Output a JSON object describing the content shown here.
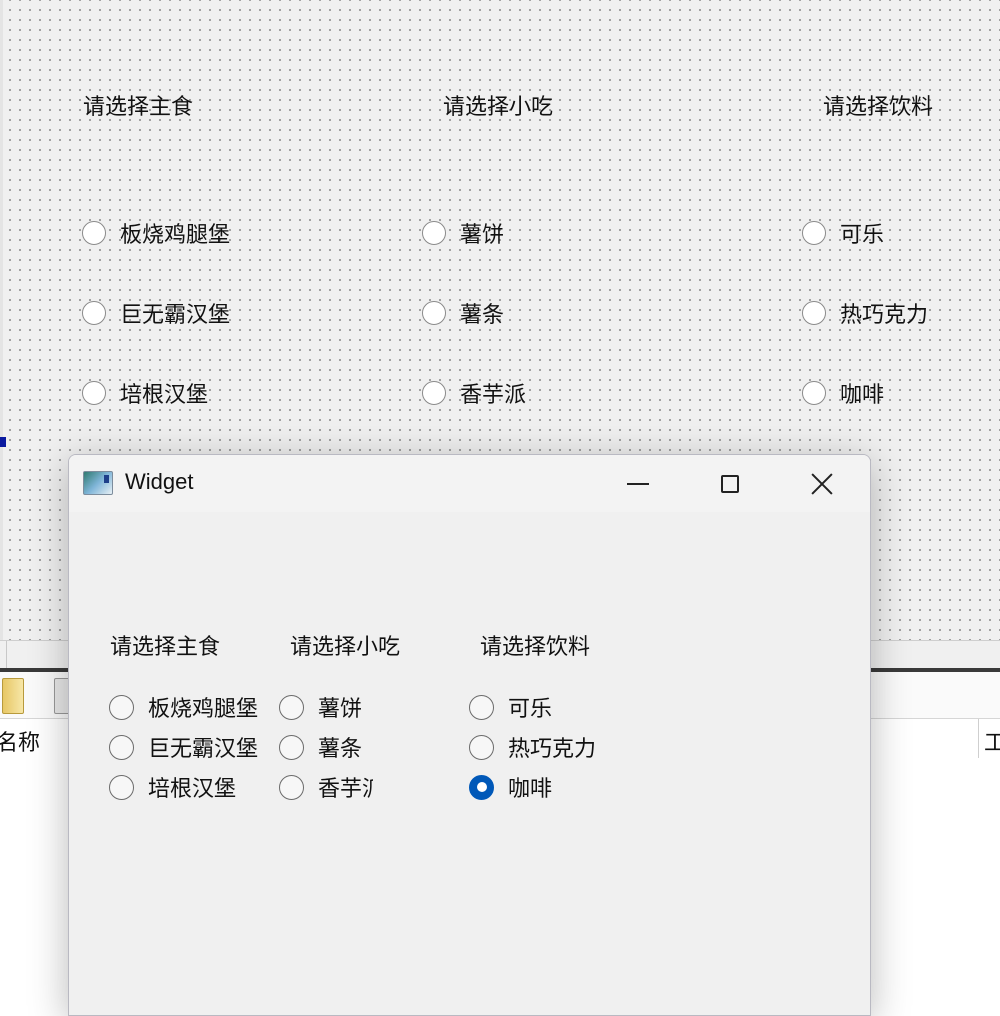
{
  "designer": {
    "headings": [
      "请选择主食",
      "请选择小吃",
      "请选择饮料"
    ],
    "staple": [
      "板烧鸡腿堡",
      "巨无霸汉堡",
      "培根汉堡"
    ],
    "snack": [
      "薯饼",
      "薯条",
      "香芋派"
    ],
    "drink": [
      "可乐",
      "热巧克力",
      "咖啡"
    ]
  },
  "explorer": {
    "col_name": "名称",
    "col_next": "工"
  },
  "window": {
    "title": "Widget",
    "headings": [
      "请选择主食",
      "请选择小吃",
      "请选择饮料"
    ],
    "staple": [
      "板烧鸡腿堡",
      "巨无霸汉堡",
      "培根汉堡"
    ],
    "snack": [
      "薯饼",
      "薯条",
      "香芋派"
    ],
    "drink": [
      "可乐",
      "热巧克力",
      "咖啡"
    ],
    "selected_drink": "咖啡"
  },
  "colors": {
    "radio_selected": "#0058b8",
    "canvas_dots": "#8c8c8c"
  }
}
